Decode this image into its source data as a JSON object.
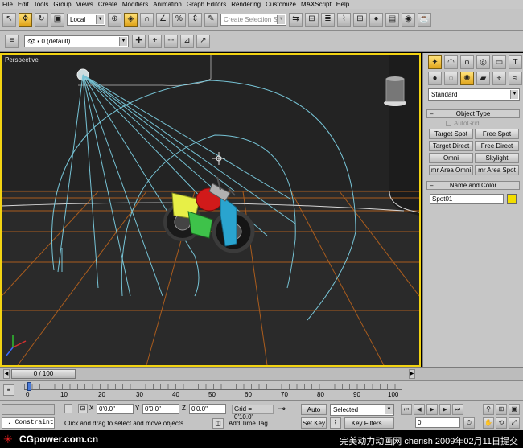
{
  "menu": [
    "File",
    "Edit",
    "Tools",
    "Group",
    "Views",
    "Create",
    "Modifiers",
    "Animation",
    "Graph Editors",
    "Rendering",
    "Customize",
    "MAXScript",
    "Help"
  ],
  "toolbar": {
    "reference_coord": "Local",
    "named_selection_placeholder": "Create Selection Set"
  },
  "layer": {
    "name": "0 (default)"
  },
  "viewport": {
    "label": "Perspective"
  },
  "command_panel": {
    "category": "Standard",
    "object_type_title": "Object Type",
    "autogrid": "AutoGrid",
    "buttons": [
      "Target Spot",
      "Free Spot",
      "Target Direct",
      "Free Direct",
      "Omni",
      "Skylight",
      "mr Area Omni",
      "mr Area Spot"
    ],
    "name_color_title": "Name and Color",
    "object_name": "Spot01",
    "object_color": "#f2dd00"
  },
  "timeline": {
    "frame_indicator": "0 / 100",
    "ticks": [
      "0",
      "10",
      "20",
      "30",
      "40",
      "50",
      "60",
      "70",
      "80",
      "90",
      "100"
    ]
  },
  "status": {
    "constraint": "Constraint",
    "prompt": "Click and drag to select and move objects",
    "x_label": "X",
    "x_value": "0'0.0\"",
    "y_label": "Y",
    "y_value": "0'0.0\"",
    "z_label": "Z",
    "z_value": "0'0.0\"",
    "grid": "Grid = 0'10.0\"",
    "add_time_tag": "Add Time Tag",
    "auto_key": "Auto Key",
    "set_key": "Set Key",
    "selected": "Selected",
    "key_filters": "Key Filters...",
    "current_frame": "0"
  },
  "watermark": {
    "left": "CGpower.com.cn",
    "right": "完美动力动画网 cherish 2009年02月11日提交"
  }
}
